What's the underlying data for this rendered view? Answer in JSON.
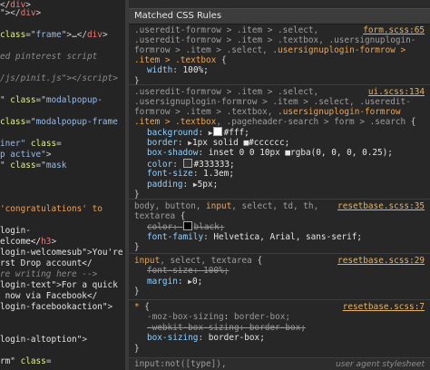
{
  "source_panel": {
    "lines": [
      [
        [
          "punc",
          "</"
        ],
        [
          "tag",
          "div"
        ],
        [
          "punc",
          ">"
        ]
      ],
      [
        [
          "punc",
          "\"></"
        ],
        [
          "tag",
          "div"
        ],
        [
          "punc",
          ">"
        ]
      ],
      [],
      [
        [
          "attr",
          "class"
        ],
        [
          "punc",
          "=\""
        ],
        [
          "str",
          "frame"
        ],
        [
          "punc",
          "\">"
        ],
        [
          "text",
          "…"
        ],
        [
          "punc",
          "</"
        ],
        [
          "tag",
          "div"
        ],
        [
          "punc",
          ">"
        ]
      ],
      [],
      [
        [
          "com",
          "ed pinterest script"
        ]
      ],
      [],
      [
        [
          "com",
          "/js/pinit.js\"></"
        ],
        [
          "com",
          "script"
        ],
        [
          "com",
          ">"
        ]
      ],
      [],
      [
        [
          "punc",
          "\" "
        ],
        [
          "attr",
          "class"
        ],
        [
          "punc",
          "=\""
        ],
        [
          "str",
          "modalpopup-"
        ]
      ],
      [],
      [
        [
          "attr",
          "class"
        ],
        [
          "punc",
          "=\""
        ],
        [
          "str",
          "modalpopup-frame"
        ]
      ],
      [],
      [
        [
          "str",
          "iner\""
        ],
        [
          "text",
          " "
        ],
        [
          "attr",
          "class"
        ],
        [
          "punc",
          "="
        ]
      ],
      [
        [
          "str",
          "p active\""
        ],
        [
          "punc",
          ">"
        ]
      ],
      [
        [
          "punc",
          "\" "
        ],
        [
          "attr",
          "class"
        ],
        [
          "punc",
          "=\""
        ],
        [
          "str",
          "mask"
        ]
      ],
      [],
      [],
      [],
      [
        [
          "q",
          "'congratulations' to"
        ]
      ],
      [],
      [
        [
          "text",
          "login-"
        ]
      ],
      [
        [
          "text",
          "elcome</"
        ],
        [
          "tag",
          "h3"
        ],
        [
          "punc",
          ">"
        ]
      ],
      [
        [
          "text",
          "login-welcomesub\""
        ],
        [
          "punc",
          ">"
        ],
        [
          "text",
          "You're"
        ]
      ],
      [
        [
          "text",
          "rst Drop account</"
        ]
      ],
      [
        [
          "com",
          "re writing here -->"
        ]
      ],
      [
        [
          "text",
          "login-text\""
        ],
        [
          "punc",
          ">"
        ],
        [
          "text",
          "For a quick"
        ]
      ],
      [
        [
          "text",
          " now via Facebook</"
        ]
      ],
      [
        [
          "text",
          "login-facebookaction\""
        ],
        [
          "punc",
          ">"
        ]
      ],
      [],
      [],
      [
        [
          "text",
          "login-altoption\""
        ],
        [
          "punc",
          ">"
        ]
      ],
      [],
      [
        [
          "text",
          "rm\" "
        ],
        [
          "attr",
          "class"
        ],
        [
          "punc",
          "="
        ]
      ]
    ],
    "line_tops": [
      0,
      12,
      24,
      36,
      48,
      72,
      84,
      108,
      120,
      128,
      140,
      152,
      164,
      176,
      188,
      200,
      212,
      224,
      236,
      248,
      260,
      268,
      280,
      292,
      304,
      316,
      328,
      340,
      352,
      364,
      376,
      376,
      388,
      396
    ]
  },
  "styles_panel": {
    "title": "Matched CSS Rules",
    "rules": [
      {
        "selector_lines": [
          [
            [
              "dim",
              ".useredit-formrow > .item > .select, "
            ]
          ],
          [
            [
              "dim",
              ".useredit-formrow > .item > .textbox, .usersignuplogin-"
            ]
          ],
          [
            [
              "dim",
              "formrow > .item > .select, "
            ],
            [
              "hi",
              ".usersignuplogin-formrow >"
            ]
          ],
          [
            [
              "hi",
              ".item > .textbox"
            ],
            [
              "brace",
              " {"
            ]
          ]
        ],
        "source": "form.scss:65",
        "declarations": [
          {
            "prop": "width",
            "value": "100%;",
            "tri": false,
            "swatch": null,
            "struck": false
          }
        ]
      },
      {
        "selector_lines": [
          [
            [
              "dim",
              ".useredit-formrow > .item > .select, "
            ]
          ],
          [
            [
              "dim",
              ".usersignuplogin-formrow > .item > .select, .useredit-"
            ]
          ],
          [
            [
              "dim",
              "formrow > .item > .textbox, "
            ],
            [
              "hi",
              ".usersignuplogin-formrow"
            ]
          ],
          [
            [
              "hi",
              ".item > .textbox"
            ],
            [
              "dim",
              ", .pageheader-search > form > .search"
            ],
            [
              "brace",
              " {"
            ]
          ]
        ],
        "source": "ui.scss:134",
        "declarations": [
          {
            "prop": "background",
            "value": "#fff;",
            "tri": true,
            "swatch": "#ffffff",
            "struck": false
          },
          {
            "prop": "border",
            "value": "1px solid ■#cccccc;",
            "tri": true,
            "swatch": null,
            "struck": false
          },
          {
            "prop": "box-shadow",
            "value": "inset 0 0 10px ■rgba(0, 0, 0, 0.25);",
            "tri": false,
            "swatch": null,
            "struck": false
          },
          {
            "prop": "color",
            "value": "#333333;",
            "tri": false,
            "swatch": "#333333",
            "struck": false
          },
          {
            "prop": "font-size",
            "value": "1.3em;",
            "tri": false,
            "swatch": null,
            "struck": false
          },
          {
            "prop": "padding",
            "value": "5px;",
            "tri": true,
            "swatch": null,
            "struck": false
          }
        ]
      },
      {
        "selector_lines": [
          [
            [
              "dim",
              "body, button, "
            ],
            [
              "hi",
              "input"
            ],
            [
              "dim",
              ", select, td, th,"
            ]
          ],
          [
            [
              "dim",
              "textarea"
            ],
            [
              "brace",
              " {"
            ]
          ]
        ],
        "source": "resetbase.scss:35",
        "declarations": [
          {
            "prop": "color",
            "value": "black;",
            "tri": false,
            "swatch": "#000000",
            "struck": true
          },
          {
            "prop": "font-family",
            "value": "Helvetica, Arial, sans-serif;",
            "tri": false,
            "swatch": null,
            "struck": false
          }
        ]
      },
      {
        "selector_lines": [
          [
            [
              "hi",
              "input"
            ],
            [
              "dim",
              ", select, textarea"
            ],
            [
              "brace",
              " {"
            ]
          ]
        ],
        "source": "resetbase.scss:29",
        "declarations": [
          {
            "prop": "font-size",
            "value": "100%;",
            "tri": false,
            "swatch": null,
            "struck": true
          },
          {
            "prop": "margin",
            "value": "0;",
            "tri": true,
            "swatch": null,
            "struck": false
          }
        ]
      },
      {
        "selector_lines": [
          [
            [
              "hi",
              "*"
            ],
            [
              "brace",
              " {"
            ]
          ]
        ],
        "source": "resetbase.scss:7",
        "declarations": [
          {
            "prop": "-moz-box-sizing",
            "value": "border-box;",
            "tri": false,
            "swatch": null,
            "struck": false,
            "dim": true
          },
          {
            "prop": "-webkit-box-sizing",
            "value": "border-box;",
            "tri": false,
            "swatch": null,
            "struck": true
          },
          {
            "prop": "box-sizing",
            "value": "border-box;",
            "tri": false,
            "swatch": null,
            "struck": false
          }
        ]
      }
    ],
    "user_agent": {
      "selector": "input:not([type]),",
      "label": "user agent stylesheet"
    }
  }
}
